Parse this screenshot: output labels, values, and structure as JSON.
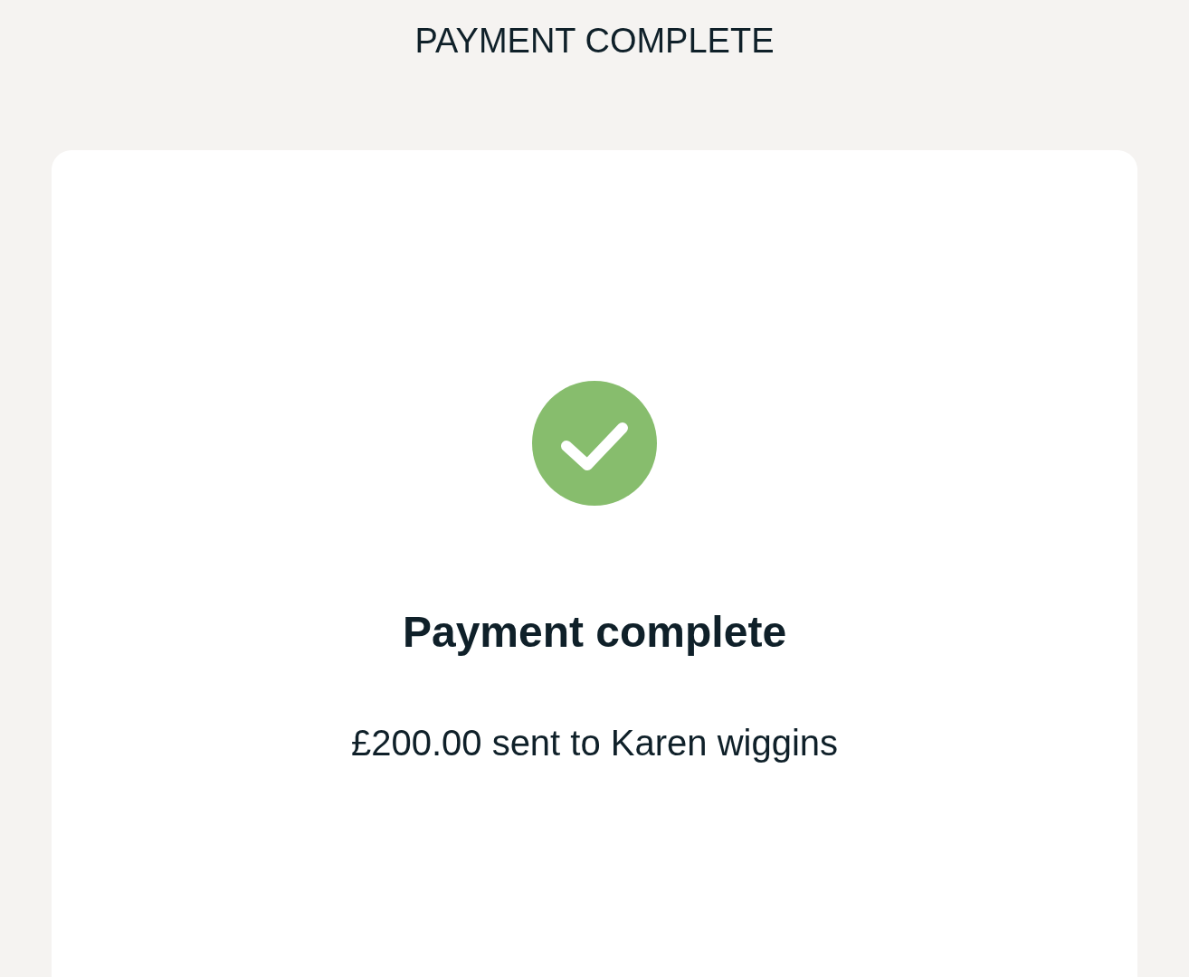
{
  "header": {
    "title": "PAYMENT COMPLETE"
  },
  "result": {
    "kind": "success",
    "title": "Payment complete",
    "message": "£200.00 sent to Karen wiggins"
  }
}
